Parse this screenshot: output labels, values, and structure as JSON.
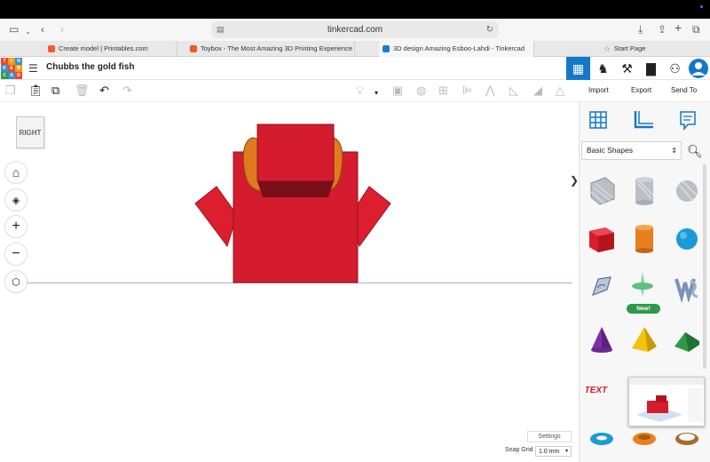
{
  "browser": {
    "url": "tinkercad.com",
    "tabs": [
      {
        "label": "Create model | Printables.com",
        "favicon_color": "#f25c2c"
      },
      {
        "label": "Toybox - The Most Amazing 3D Printing Experience for Kids",
        "favicon_color": "#ee5a24"
      },
      {
        "label": "3D design Amazing Esboo-Lahdi - Tinkercad",
        "favicon_color": "#1d7cd6"
      },
      {
        "label": "Start Page",
        "favicon_color": "#888888"
      }
    ]
  },
  "app": {
    "logo_letters": [
      "T",
      "I",
      "N",
      "K",
      "E",
      "R",
      "C",
      "A",
      "D"
    ],
    "logo_colors": [
      "#e64a2e",
      "#f39c12",
      "#3a8fd6",
      "#3a8fd6",
      "#e64a2e",
      "#f39c12",
      "#2e9b49",
      "#3a8fd6",
      "#e64a2e"
    ],
    "title": "Chubbs the gold fish",
    "accent": "#1478c8"
  },
  "side_actions": {
    "import": "Import",
    "export": "Export",
    "send_to": "Send To"
  },
  "viewcube": {
    "face": "RIGHT"
  },
  "canvas": {
    "settings_label": "Settings",
    "snap_label": "Snap Grid",
    "snap_value": "1.0 mm"
  },
  "panel": {
    "category": "Basic Shapes",
    "new_badge": "New!",
    "thumbnail_text": "RIGHT"
  }
}
